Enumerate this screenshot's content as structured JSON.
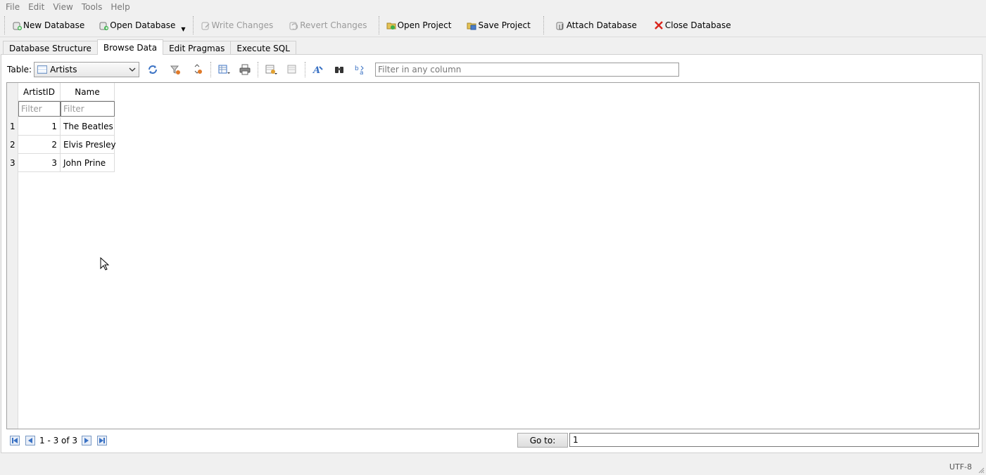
{
  "menu": [
    "File",
    "Edit",
    "View",
    "Tools",
    "Help"
  ],
  "toolbar": {
    "new_database": "New Database",
    "open_database": "Open Database",
    "write_changes": "Write Changes",
    "revert_changes": "Revert Changes",
    "open_project": "Open Project",
    "save_project": "Save Project",
    "attach_database": "Attach Database",
    "close_database": "Close Database"
  },
  "tabs": [
    "Database Structure",
    "Browse Data",
    "Edit Pragmas",
    "Execute SQL"
  ],
  "active_tab": "Browse Data",
  "browse": {
    "table_label": "Table:",
    "table_selected": "Artists",
    "filter_placeholder": "Filter in any column"
  },
  "grid": {
    "columns": [
      "ArtistID",
      "Name"
    ],
    "filter_placeholder": "Filter",
    "rows": [
      {
        "num": "1",
        "ArtistID": "1",
        "Name": "The Beatles"
      },
      {
        "num": "2",
        "ArtistID": "2",
        "Name": "Elvis Presley"
      },
      {
        "num": "3",
        "ArtistID": "3",
        "Name": "John Prine"
      }
    ]
  },
  "nav": {
    "range": "1 - 3 of 3",
    "goto_label": "Go to:",
    "goto_value": "1"
  },
  "status": {
    "encoding": "UTF-8"
  },
  "colors": {
    "accent_blue": "#3a72c4",
    "close_red": "#d9251c",
    "disabled_text": "#9a9a9a"
  }
}
